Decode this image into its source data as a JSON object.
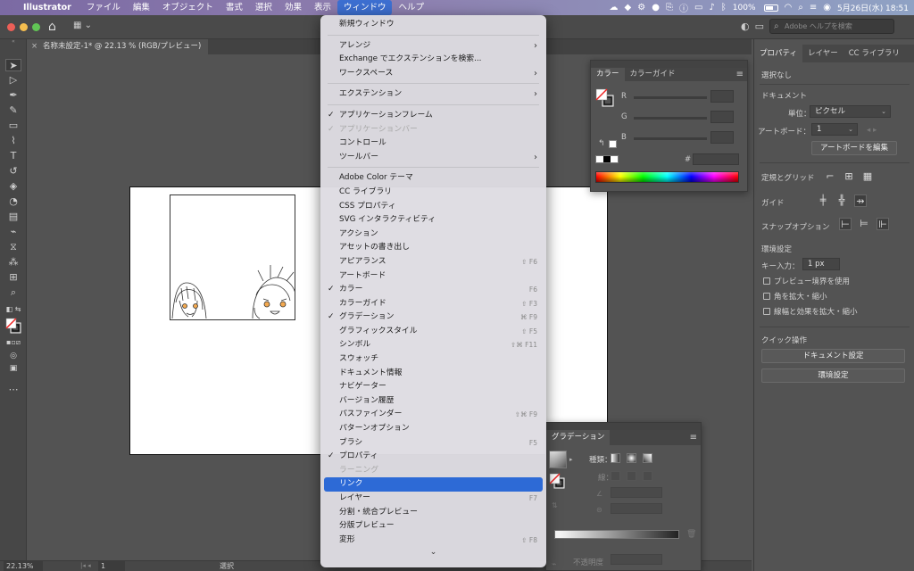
{
  "menubar": {
    "app": "Illustrator",
    "items": [
      "ファイル",
      "編集",
      "オブジェクト",
      "書式",
      "選択",
      "効果",
      "表示",
      "ウィンドウ",
      "ヘルプ"
    ],
    "active_index": 7,
    "battery": "100%",
    "datetime": "5月26日(水)  18:51"
  },
  "appbar": {
    "search_placeholder": "Adobe ヘルプを検索"
  },
  "document_tab": {
    "title": "名称未設定-1* @ 22.13 % (RGB/プレビュー)"
  },
  "window_menu": {
    "items": [
      {
        "label": "新規ウィンドウ"
      },
      {
        "separator": true
      },
      {
        "label": "アレンジ",
        "submenu": true
      },
      {
        "label": "Exchange でエクステンションを検索..."
      },
      {
        "label": "ワークスペース",
        "submenu": true
      },
      {
        "separator": true
      },
      {
        "label": "エクステンション",
        "submenu": true
      },
      {
        "separator": true
      },
      {
        "label": "アプリケーションフレーム",
        "checked": true
      },
      {
        "label": "アプリケーションバー",
        "checked": true,
        "disabled": true
      },
      {
        "label": "コントロール"
      },
      {
        "label": "ツールバー",
        "submenu": true
      },
      {
        "separator": true
      },
      {
        "label": "Adobe Color テーマ"
      },
      {
        "label": "CC ライブラリ"
      },
      {
        "label": "CSS プロパティ"
      },
      {
        "label": "SVG インタラクティビティ"
      },
      {
        "label": "アクション"
      },
      {
        "label": "アセットの書き出し"
      },
      {
        "label": "アピアランス",
        "shortcut": "⇧ F6"
      },
      {
        "label": "アートボード"
      },
      {
        "label": "カラー",
        "checked": true,
        "shortcut": "F6"
      },
      {
        "label": "カラーガイド",
        "shortcut": "⇧ F3"
      },
      {
        "label": "グラデーション",
        "checked": true,
        "shortcut": "⌘ F9"
      },
      {
        "label": "グラフィックスタイル",
        "shortcut": "⇧ F5"
      },
      {
        "label": "シンボル",
        "shortcut": "⇧⌘ F11"
      },
      {
        "label": "スウォッチ"
      },
      {
        "label": "ドキュメント情報"
      },
      {
        "label": "ナビゲーター"
      },
      {
        "label": "バージョン履歴"
      },
      {
        "label": "パスファインダー",
        "shortcut": "⇧⌘ F9"
      },
      {
        "label": "パターンオプション"
      },
      {
        "label": "ブラシ",
        "shortcut": "F5"
      },
      {
        "label": "プロパティ",
        "checked": true
      },
      {
        "label": "ラーニング",
        "disabled": true
      },
      {
        "label": "リンク",
        "selected": true
      },
      {
        "label": "レイヤー",
        "shortcut": "F7"
      },
      {
        "label": "分割・統合プレビュー"
      },
      {
        "label": "分版プレビュー"
      },
      {
        "label": "変形",
        "shortcut": "⇧ F8"
      }
    ],
    "scroll_indicator": "⌄"
  },
  "color_panel": {
    "tabs": [
      "カラー",
      "カラーガイド"
    ],
    "channels": [
      "R",
      "G",
      "B"
    ],
    "hex_label": "#"
  },
  "gradient_panel": {
    "tab": "グラデーション",
    "type_label": "種類：",
    "stroke_label": "線：",
    "opacity_label": "不透明度"
  },
  "properties_panel": {
    "tabs": [
      "プロパティ",
      "レイヤー",
      "CC ライブラリ"
    ],
    "selection": "選択なし",
    "document_heading": "ドキュメント",
    "unit_label": "単位：",
    "unit_value": "ピクセル",
    "artboard_label": "アートボード：",
    "artboard_value": "1",
    "edit_artboard": "アートボードを編集",
    "rulers_grid": "定規とグリッド",
    "guides": "ガイド",
    "snap_options": "スナップオプション",
    "preferences": "環境設定",
    "key_input_label": "キー入力：",
    "key_input_value": "1 px",
    "cb_preview_bounds": "プレビュー境界を使用",
    "cb_scale_corners": "角を拡大・縮小",
    "cb_scale_strokes": "線幅と効果を拡大・縮小",
    "quick_actions": "クイック操作",
    "doc_setup_button": "ドキュメント設定",
    "prefs_button": "環境設定"
  },
  "statusbar": {
    "zoom": "22.13%",
    "page": "1",
    "tool": "選択"
  }
}
